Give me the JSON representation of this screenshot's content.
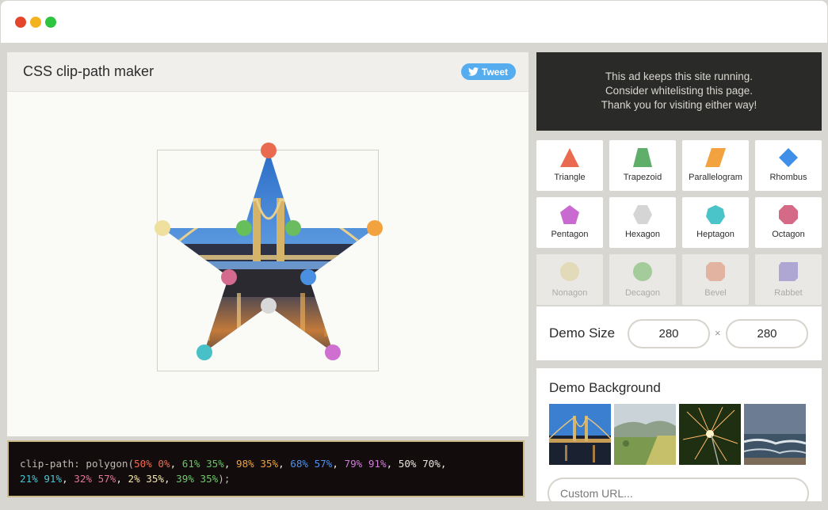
{
  "window": {
    "controls": [
      "close",
      "minimize",
      "maximize"
    ]
  },
  "main": {
    "title": "CSS clip-path maker",
    "tweet_label": "Tweet",
    "handles": [
      {
        "name": "handle-1",
        "color": "#e96a4f"
      },
      {
        "name": "handle-2",
        "color": "#6bbb5f"
      },
      {
        "name": "handle-3",
        "color": "#f2a23f"
      },
      {
        "name": "handle-4",
        "color": "#4a90e2"
      },
      {
        "name": "handle-5",
        "color": "#cf6fd0"
      },
      {
        "name": "handle-6",
        "color": "#d8d8d8"
      },
      {
        "name": "handle-7",
        "color": "#48c0c8"
      },
      {
        "name": "handle-8",
        "color": "#d46a8e"
      },
      {
        "name": "handle-9",
        "color": "#efe09f"
      },
      {
        "name": "handle-10",
        "color": "#66bf5a"
      }
    ]
  },
  "code": {
    "prefix": "clip-path: polygon(",
    "points": [
      {
        "text": "50% 0%",
        "color": "#ef6b54"
      },
      {
        "text": "61% 35%",
        "color": "#66c764"
      },
      {
        "text": "98% 35%",
        "color": "#f1a23d"
      },
      {
        "text": "68% 57%",
        "color": "#4b92ee"
      },
      {
        "text": "79% 91%",
        "color": "#d07bd8"
      },
      {
        "text": "50% 70%",
        "color": "#e8e6df"
      },
      {
        "text": "21% 91%",
        "color": "#4cc4cf"
      },
      {
        "text": "32% 57%",
        "color": "#e27599"
      },
      {
        "text": "2% 35%",
        "color": "#f3e8a9"
      },
      {
        "text": "39% 35%",
        "color": "#6ccb68"
      }
    ],
    "suffix": ");",
    "sep": ", "
  },
  "ad": {
    "line1": "This ad keeps this site running.",
    "line2": "Consider whitelisting this page.",
    "line3": "Thank you for visiting either way!"
  },
  "shapes": [
    {
      "label": "Triangle",
      "icon": "triangle-icon",
      "color": "#e96a4f"
    },
    {
      "label": "Trapezoid",
      "icon": "trapezoid-icon",
      "color": "#5fae6a"
    },
    {
      "label": "Parallelogram",
      "icon": "parallelogram-icon",
      "color": "#f2a23f"
    },
    {
      "label": "Rhombus",
      "icon": "rhombus-icon",
      "color": "#3f8ee8"
    },
    {
      "label": "Pentagon",
      "icon": "pentagon-icon",
      "color": "#c86ad0"
    },
    {
      "label": "Hexagon",
      "icon": "hexagon-icon",
      "color": "#d5d5d5"
    },
    {
      "label": "Heptagon",
      "icon": "heptagon-icon",
      "color": "#4ac3c9"
    },
    {
      "label": "Octagon",
      "icon": "octagon-icon",
      "color": "#d46a86"
    },
    {
      "label": "Nonagon",
      "icon": "nonagon-icon",
      "color": "#efe09f"
    },
    {
      "label": "Decagon",
      "icon": "decagon-icon",
      "color": "#66bf5a"
    },
    {
      "label": "Bevel",
      "icon": "bevel-icon",
      "color": "#ef8a6a"
    },
    {
      "label": "Rabbet",
      "icon": "rabbet-icon",
      "color": "#7f70d8"
    }
  ],
  "size": {
    "label": "Demo Size",
    "width": "280",
    "height": "280",
    "separator": "×"
  },
  "background": {
    "label": "Demo Background",
    "thumbs": [
      "bridge-thumbnail",
      "valley-thumbnail",
      "sparkler-thumbnail",
      "beach-thumbnail"
    ],
    "custom_url_placeholder": "Custom URL..."
  }
}
